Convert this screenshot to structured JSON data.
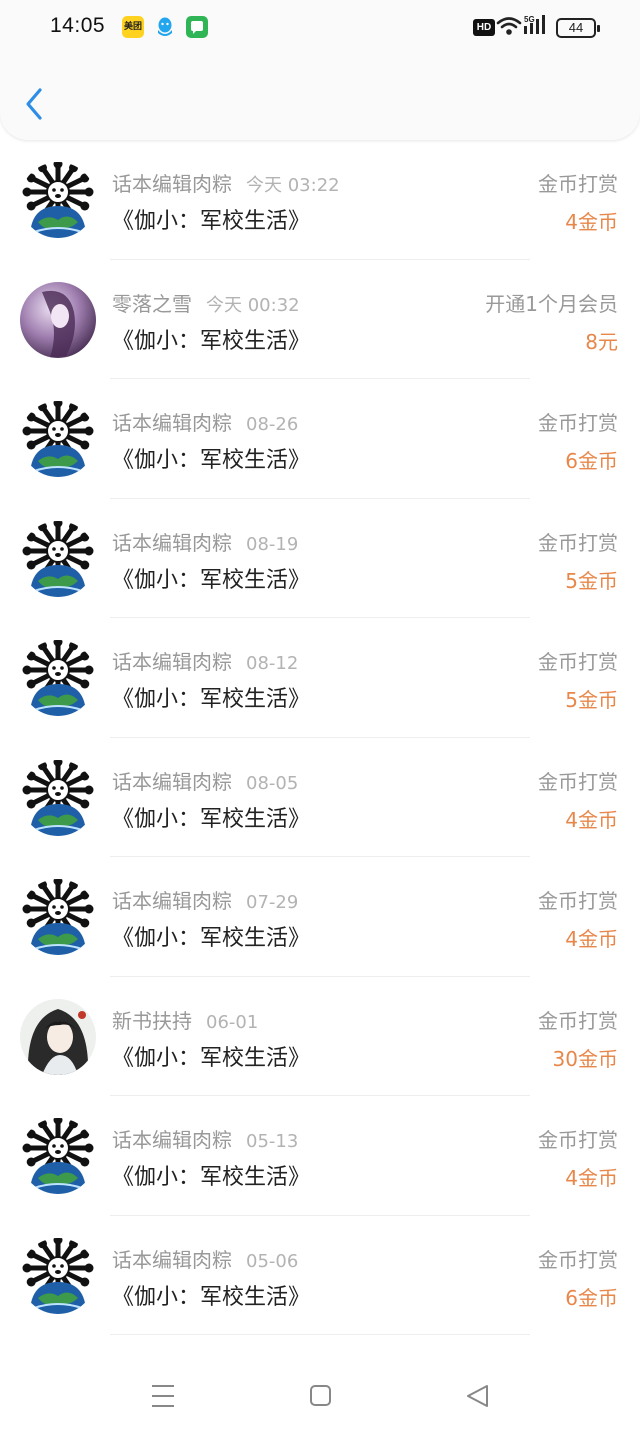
{
  "status_bar": {
    "time": "14:05",
    "meituan_label": "美团",
    "hd_label": "HD",
    "battery": "44"
  },
  "colors": {
    "accent": "#2e8ee6",
    "amount": "#e8874a",
    "muted": "#999999"
  },
  "records": [
    {
      "name": "话本编辑肉粽",
      "date": "今天 03:22",
      "book": "《伽小：军校生活》",
      "type": "金币打赏",
      "amount": "4金币",
      "avatar": "editor"
    },
    {
      "name": "零落之雪",
      "date": "今天 00:32",
      "book": "《伽小：军校生活》",
      "type": "开通1个月会员",
      "amount": "8元",
      "avatar": "purple"
    },
    {
      "name": "话本编辑肉粽",
      "date": "08-26",
      "book": "《伽小：军校生活》",
      "type": "金币打赏",
      "amount": "6金币",
      "avatar": "editor"
    },
    {
      "name": "话本编辑肉粽",
      "date": "08-19",
      "book": "《伽小：军校生活》",
      "type": "金币打赏",
      "amount": "5金币",
      "avatar": "editor"
    },
    {
      "name": "话本编辑肉粽",
      "date": "08-12",
      "book": "《伽小：军校生活》",
      "type": "金币打赏",
      "amount": "5金币",
      "avatar": "editor"
    },
    {
      "name": "话本编辑肉粽",
      "date": "08-05",
      "book": "《伽小：军校生活》",
      "type": "金币打赏",
      "amount": "4金币",
      "avatar": "editor"
    },
    {
      "name": "话本编辑肉粽",
      "date": "07-29",
      "book": "《伽小：军校生活》",
      "type": "金币打赏",
      "amount": "4金币",
      "avatar": "editor"
    },
    {
      "name": "新书扶持",
      "date": "06-01",
      "book": "《伽小：军校生活》",
      "type": "金币打赏",
      "amount": "30金币",
      "avatar": "anime"
    },
    {
      "name": "话本编辑肉粽",
      "date": "05-13",
      "book": "《伽小：军校生活》",
      "type": "金币打赏",
      "amount": "4金币",
      "avatar": "editor"
    },
    {
      "name": "话本编辑肉粽",
      "date": "05-06",
      "book": "《伽小：军校生活》",
      "type": "金币打赏",
      "amount": "6金币",
      "avatar": "editor"
    }
  ]
}
